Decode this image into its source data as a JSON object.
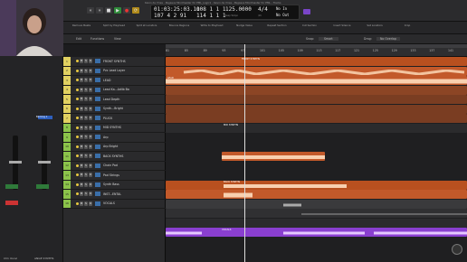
{
  "window": {
    "title": "Kevin de Vries - Pegasus Mixdmaster for PML_Logic1 - Kevin de Vries - Pegasus Mixdmaster for PML - Tracks"
  },
  "transport": {
    "bars_position": "01:03:25:03.10",
    "sub_position": "107 4 2 91",
    "bar": "108 1 1 1",
    "bar2": "114 1 1 1",
    "tempo": "125.0000",
    "tempo_label": "Keep Tempo",
    "time_sig": "4/4",
    "time_sig_sub": "/16",
    "in_label": "No In",
    "out_label": "No Out"
  },
  "toolbar": [
    "Remove Beats",
    "Split by Playhead",
    "Split at Locators",
    "Bounce Regions",
    "Write to Playhead",
    "Nudge Value",
    "Repeat Section",
    "Cut Section",
    "Insert Silence",
    "Set Locators",
    "Crop"
  ],
  "control_bar": {
    "edit": "Edit",
    "functions": "Functions",
    "view": "View",
    "snap_label": "Snap:",
    "snap_value": "Smart",
    "drag_label": "Drag:",
    "drag_value": "No Overlap"
  },
  "ruler_ticks": [
    "81",
    "85",
    "89",
    "93",
    "97",
    "101",
    "105",
    "109",
    "113",
    "117",
    "121",
    "125",
    "129",
    "133",
    "137",
    "141"
  ],
  "tracks": [
    {
      "num": "1",
      "name": "FRONT SYNTHS",
      "color": "#e0d060",
      "type": "folder"
    },
    {
      "num": "2",
      "name": "Pvc Lead Layer",
      "color": "#e0d060",
      "type": "audio"
    },
    {
      "num": "3",
      "name": "LEAD",
      "color": "#e0d060",
      "type": "audio"
    },
    {
      "num": "4",
      "name": "Lead Ka...Adlib Ba",
      "color": "#e0d060",
      "type": "audio"
    },
    {
      "num": "5",
      "name": "Lead Depth",
      "color": "#e0d060",
      "type": "audio"
    },
    {
      "num": "6",
      "name": "Synth...Bright",
      "color": "#e0d060",
      "type": "audio"
    },
    {
      "num": "7",
      "name": "PLUCK",
      "color": "#e0d060",
      "type": "audio"
    },
    {
      "num": "8",
      "name": "MID SYNTHS",
      "color": "#8bc34a",
      "type": "folder"
    },
    {
      "num": "9",
      "name": "Arp",
      "color": "#8bc34a",
      "type": "audio"
    },
    {
      "num": "10",
      "name": "Arp Bright",
      "color": "#8bc34a",
      "type": "audio"
    },
    {
      "num": "11",
      "name": "BACK SYNTHS",
      "color": "#8bc34a",
      "type": "folder"
    },
    {
      "num": "12",
      "name": "Chain Pad",
      "color": "#8bc34a",
      "type": "audio"
    },
    {
      "num": "13",
      "name": "Pad Strings",
      "color": "#8bc34a",
      "type": "audio"
    },
    {
      "num": "14",
      "name": "Synth Bass",
      "color": "#8bc34a",
      "type": "audio"
    },
    {
      "num": "15",
      "name": "INST...ENTAL",
      "color": "#8bc34a",
      "type": "folder"
    },
    {
      "num": "16",
      "name": "VOCALS",
      "color": "#8bc34a",
      "type": "folder"
    }
  ],
  "regions": [
    {
      "label": "FRONT SYNTHS",
      "track": 0
    },
    {
      "label": "LEAD",
      "track": 2
    },
    {
      "label": "MID SYNTHS",
      "track": 7
    },
    {
      "label": "BACK SYNTHS",
      "track": 10
    },
    {
      "label": "VOCALS",
      "track": 15
    }
  ],
  "mixer": {
    "ch1": "Ch1 Vocal",
    "ch2": "ANGE SYNTHS",
    "bus": "Backing 1"
  },
  "colors": {
    "orange": "#d0622a",
    "orange_light": "#f09a5c",
    "purple": "#8a3fd0",
    "grey_region": "#4a4a4c"
  }
}
